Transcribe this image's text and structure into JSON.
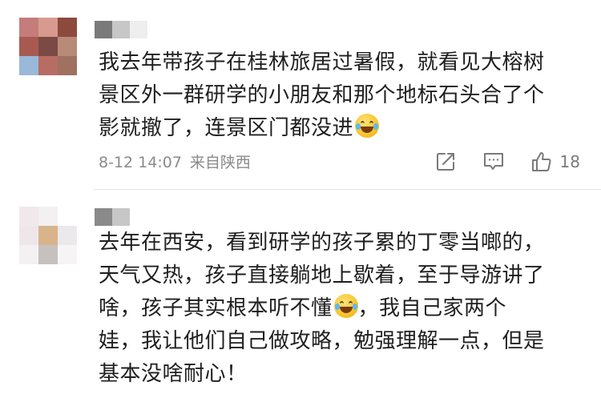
{
  "comments": [
    {
      "avatar_colors": [
        "#c47d7a",
        "#d89a8e",
        "#8c4a3c",
        "#a85a50",
        "#7b4a44",
        "#b98a78",
        "#9ab8d8",
        "#b76d64",
        "#a07060"
      ],
      "username_colors": [
        "#7a7a7a",
        "#c7c7c7",
        "#eeeeee"
      ],
      "text_lines": [
        "我去年带孩子在桂林旅居过暑假，就看见大榕树",
        "景区外一群研学的小朋友和那个地标石头合了个",
        "影就撤了，连景区门都没进"
      ],
      "timestamp": "8-12 14:07",
      "location": "来自陕西",
      "like_count": "18"
    },
    {
      "avatar_colors": [
        "#f1e8ec",
        "#f3f0f2",
        "#ffffff",
        "#efe6ea",
        "#d9b48a",
        "#ece9ec",
        "#f4f1f3",
        "#c6c1bf",
        "#f7f4f6"
      ],
      "username_colors": [
        "#8a8a8a",
        "#c7c7c7",
        "#ffffff"
      ],
      "text_lines": [
        "去年在西安，看到研学的孩子累的丁零当啷的，",
        "天气又热，孩子直接躺地上歇着，至于导游讲了",
        "啥，孩子其实根本听不懂",
        "，我自己家两个",
        "娃，我让他们自己做攻略，勉强理解一点，但是",
        "基本没啥耐心！"
      ]
    }
  ],
  "icons": {
    "share": "share-icon",
    "comment": "comment-icon",
    "like": "thumbs-up-icon",
    "emoji_laugh": "laughing-tears-emoji",
    "emoji_cry": "crying-laughing-emoji"
  },
  "colors": {
    "icon": "#7a7a7a",
    "meta_text": "#8a8a8a",
    "body_text": "#1f1f1f"
  }
}
